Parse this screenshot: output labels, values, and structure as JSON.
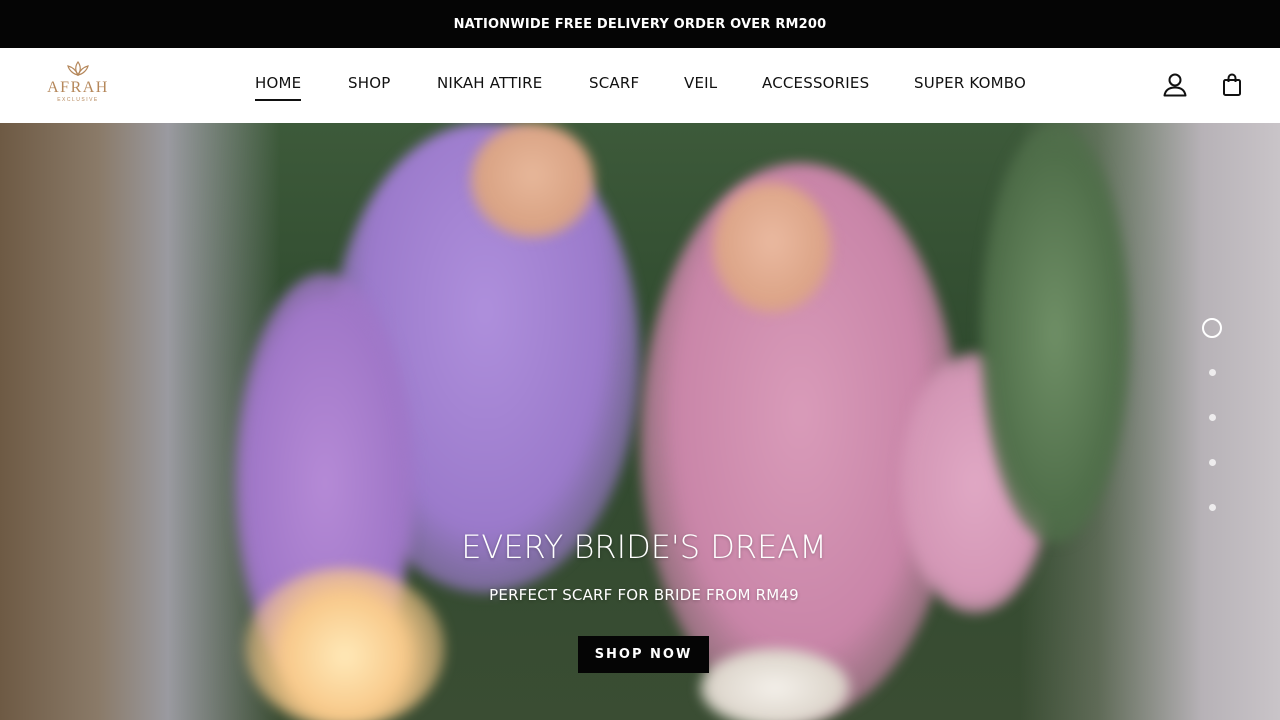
{
  "announcement": {
    "text": "NATIONWIDE FREE DELIVERY ORDER OVER RM200"
  },
  "brand": {
    "name": "AFRAH",
    "tagline": "EXCLUSIVE",
    "color": "#b5875a"
  },
  "nav": {
    "items": [
      {
        "label": "HOME",
        "active": true
      },
      {
        "label": "SHOP",
        "active": false
      },
      {
        "label": "NIKAH ATTIRE",
        "active": false
      },
      {
        "label": "SCARF",
        "active": false
      },
      {
        "label": "VEIL",
        "active": false
      },
      {
        "label": "ACCESSORIES",
        "active": false
      },
      {
        "label": "SUPER KOMBO",
        "active": false
      }
    ]
  },
  "header_icons": {
    "account": "user-icon",
    "cart": "shopping-bag-icon"
  },
  "hero": {
    "title": "EVERY BRIDE'S DREAM",
    "subtitle": "PERFECT SCARF FOR BRIDE FROM RM49",
    "cta_label": "SHOP NOW",
    "slides_total": 5,
    "active_slide": 1
  }
}
